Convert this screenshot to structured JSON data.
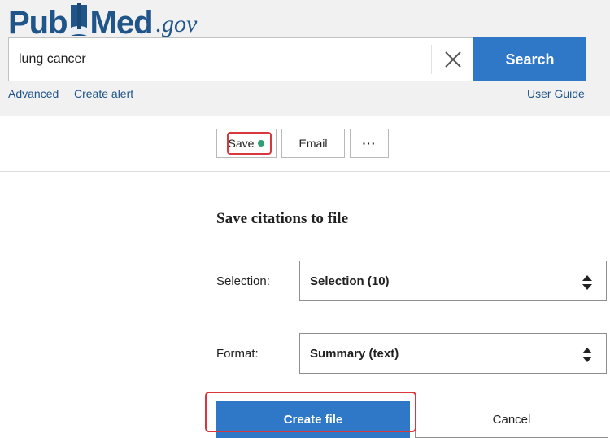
{
  "brand": {
    "logo_part1": "Pub",
    "logo_part2": "Med",
    "logo_suffix": ".gov",
    "color": "#20558a"
  },
  "search": {
    "query": "lung cancer",
    "clear_icon": "close-icon",
    "button_label": "Search",
    "button_color": "#2e78c7"
  },
  "header_links": {
    "advanced": "Advanced",
    "create_alert": "Create alert",
    "user_guide": "User Guide"
  },
  "toolbar": {
    "save_label": "Save",
    "save_indicator_color": "#2fa074",
    "email_label": "Email",
    "more_label": "···"
  },
  "save_panel": {
    "title": "Save citations to file",
    "selection_label": "Selection:",
    "selection_value": "Selection (10)",
    "format_label": "Format:",
    "format_value": "Summary (text)",
    "select_icon": "sort-arrows-icon",
    "create_label": "Create file",
    "cancel_label": "Cancel"
  },
  "highlight_color": "#d9363e"
}
